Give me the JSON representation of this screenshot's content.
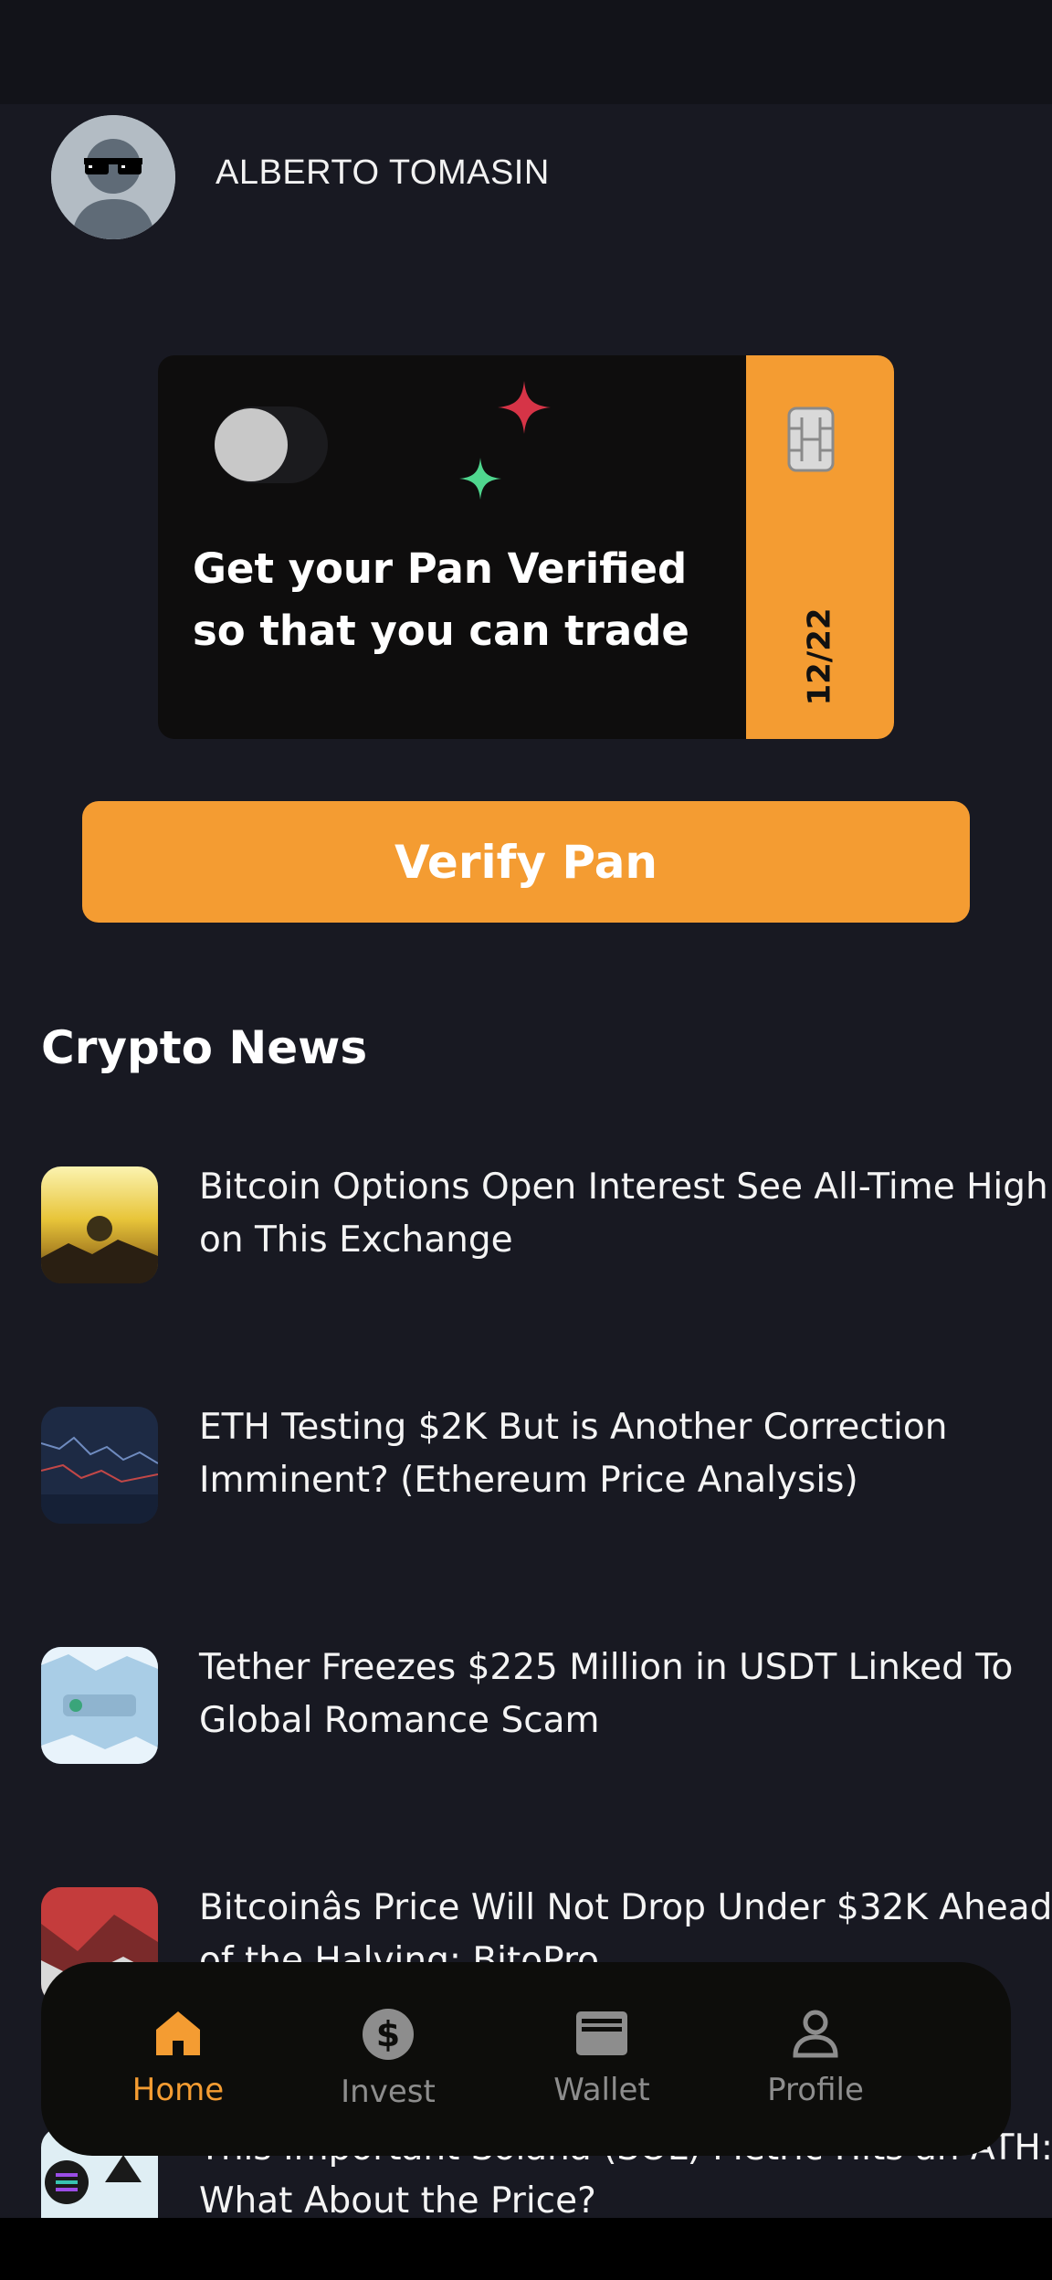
{
  "user": {
    "name": "ALBERTO TOMASIN"
  },
  "card": {
    "message": "Get your Pan Verified so that you can trade",
    "expiry": "12/22"
  },
  "verify_button": {
    "label": "Verify Pan"
  },
  "news": {
    "title": "Crypto News",
    "items": [
      {
        "title": "Bitcoin Options Open Interest See All-Time High on This Exchange"
      },
      {
        "title": "ETH Testing $2K But is Another Correction Imminent? (Ethereum Price Analysis)"
      },
      {
        "title": "Tether Freezes $225 Million in USDT Linked To Global Romance Scam"
      },
      {
        "title": "Bitcoinâs Price Will Not Drop Under $32K Ahead of the Halving: BitoPro"
      },
      {
        "title": "This Important Solana (SOL) Metric Hits an ATH: What About the Price?"
      }
    ]
  },
  "nav": {
    "items": [
      {
        "label": "Home",
        "icon": "home-icon",
        "active": true
      },
      {
        "label": "Invest",
        "icon": "dollar-icon",
        "active": false
      },
      {
        "label": "Wallet",
        "icon": "wallet-icon",
        "active": false
      },
      {
        "label": "Profile",
        "icon": "user-icon",
        "active": false
      }
    ]
  },
  "colors": {
    "accent": "#f49c32",
    "background": "#181922",
    "card": "#0e0d0d",
    "sparkle_red": "#d63447",
    "sparkle_green": "#4fd68e"
  }
}
